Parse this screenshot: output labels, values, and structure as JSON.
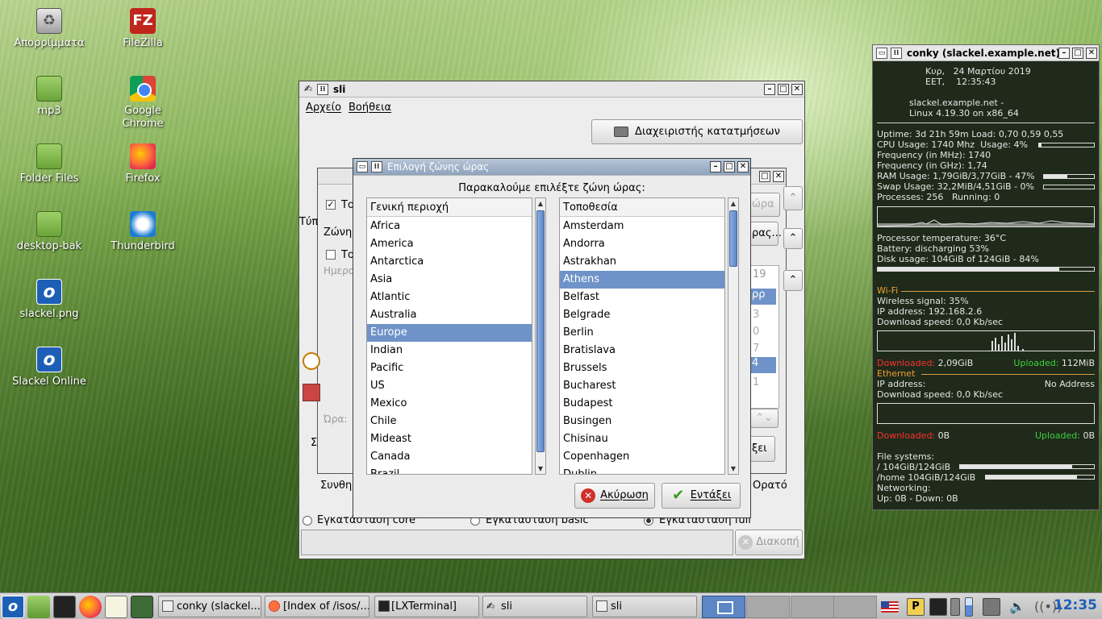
{
  "desktop": {
    "icons": [
      {
        "label": "Απορρίμματα",
        "icon": "trash-icon"
      },
      {
        "label": "FileZilla",
        "icon": "filezilla-icon"
      },
      {
        "label": "mp3",
        "icon": "folder-icon"
      },
      {
        "label": "Google Chrome",
        "icon": "chrome-icon"
      },
      {
        "label": "Folder Files",
        "icon": "folder-icon"
      },
      {
        "label": "Firefox",
        "icon": "firefox-icon"
      },
      {
        "label": "desktop-bak",
        "icon": "folder-icon"
      },
      {
        "label": "Thunderbird",
        "icon": "thunderbird-icon"
      },
      {
        "label": "slackel.png",
        "icon": "slackel-icon"
      },
      {
        "label": "Slackel Online",
        "icon": "slackel-icon"
      }
    ]
  },
  "sli": {
    "title": "sli",
    "menu": [
      "Αρχείο",
      "Βοήθεια"
    ],
    "partition_button": "Διαχειριστής κατατμήσεων",
    "bg": {
      "to1": "Το",
      "type": "Τύπ",
      "zone": "Ζώνη",
      "to2": "Το",
      "date": "Ημερο",
      "time": "Ώρα:",
      "sigma": "Σ",
      "now": "ώρα",
      "ras": "ρας...",
      "cal_year": "19",
      "cal_sel": "ρρ",
      "cal_3": "3",
      "cal_0": "0",
      "cal_7": "7",
      "cal_4": "4",
      "cal_1": "1",
      "ksi": "ξει",
      "synth": "Συνθη",
      "orato": "Ορατό"
    },
    "install": {
      "core": "Εγκατάσταση core",
      "basic": "Εγκατάσταση basic",
      "full": "Εγκατάσταση full"
    },
    "abort_button": "Διακοπή"
  },
  "tz_dialog": {
    "title": "Επιλογή ζώνης ώρας",
    "prompt": "Παρακαλούμε επιλέξτε ζώνη ώρας:",
    "region_header": "Γενική περιοχή",
    "regions": [
      "Africa",
      "America",
      "Antarctica",
      "Asia",
      "Atlantic",
      "Australia",
      "Europe",
      "Indian",
      "Pacific",
      "US",
      "Mexico",
      "Chile",
      "Mideast",
      "Canada",
      "Brazil"
    ],
    "region_selected": "Europe",
    "location_header": "Τοποθεσία",
    "locations": [
      "Amsterdam",
      "Andorra",
      "Astrakhan",
      "Athens",
      "Belfast",
      "Belgrade",
      "Berlin",
      "Bratislava",
      "Brussels",
      "Bucharest",
      "Budapest",
      "Busingen",
      "Chisinau",
      "Copenhagen",
      "Dublin"
    ],
    "location_selected": "Athens",
    "cancel": "Ακύρωση",
    "ok": "Εντάξει"
  },
  "conky": {
    "title": "conky (slackel.example.net)",
    "day": "Κυρ,",
    "date": "24 Μαρτίου 2019",
    "tz": "EET,",
    "time": "12:35:43",
    "host": "slackel.example.net -",
    "kernel": "Linux 4.19.30 on x86_64",
    "uptime": "Uptime: 3d 21h 59m",
    "load": "Load: 0,70 0,59 0,55",
    "cpu": "CPU Usage:  1740 Mhz",
    "cpu_usage": "Usage:  4%",
    "cpu_usage_pct": 4,
    "freq_mhz": "Frequency (in MHz): 1740",
    "freq_ghz": "Frequency (in GHz): 1,74",
    "ram": "RAM Usage:  1,79GiB/3,77GiB - 47%",
    "ram_pct": 47,
    "swap": "Swap Usage:  32,2MiB/4,51GiB - 0%",
    "swap_pct": 0,
    "processes": "Processes:  256",
    "running": "Running:  0",
    "temp": "Processor temperature:  36°C",
    "battery": "Battery:  discharging 53%",
    "disk": "Disk usage:  104GiB of 124GiB - 84%",
    "disk_pct": 84,
    "wifi_header": "Wi-Fi",
    "wireless": "Wireless signal:  35%",
    "ip": "IP address:  192.168.2.6",
    "dl_speed": "Download speed:  0,0 Kb/sec",
    "downloaded_label": "Downloaded:",
    "downloaded_wifi": "2,09GiB",
    "uploaded_label": "Uploaded:",
    "uploaded_wifi": "112MiB",
    "eth_header": "Ethernet",
    "eth_ip_label": "IP address:",
    "eth_ip": "No Address",
    "eth_dl_speed": "Download speed:  0,0 Kb/sec",
    "downloaded_eth": "0B",
    "uploaded_eth": "0B",
    "fs_header": "File systems:",
    "fs_root": " /  104GiB/124GiB",
    "fs_root_pct": 84,
    "fs_home": " /home  104GiB/124GiB",
    "fs_home_pct": 84,
    "networking": "Networking:",
    "up": " Up:  0B",
    "down": "  -  Down:  0B"
  },
  "taskbar": {
    "tasks": [
      {
        "label": "conky (slackel....",
        "icon": "window-icon"
      },
      {
        "label": "[Index of /isos/...",
        "icon": "firefox-icon"
      },
      {
        "label": "[LXTerminal]",
        "icon": "terminal-icon"
      },
      {
        "label": "sli",
        "icon": "sli-icon"
      },
      {
        "label": "sli",
        "icon": "window-icon"
      }
    ],
    "clock": "12:35"
  },
  "colors": {
    "selection": "#6f93c8",
    "conky_bg": "#1f2a1a",
    "conky_red": "#ff3030",
    "conky_green": "#3cd23c",
    "clock": "#1f5fb8"
  }
}
